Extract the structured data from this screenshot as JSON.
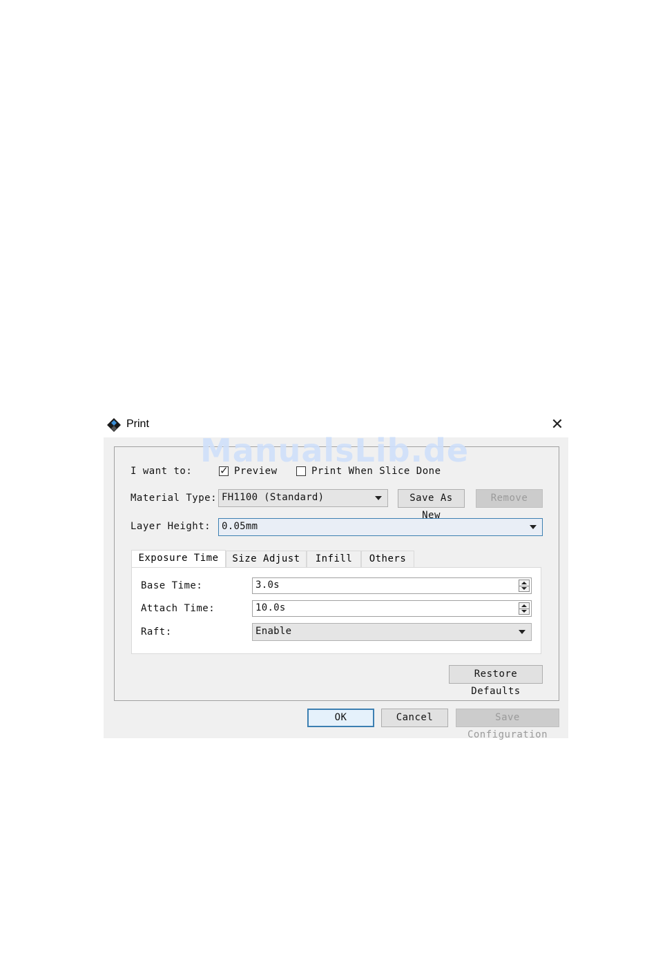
{
  "window": {
    "title": "Print",
    "close_glyph": "✕",
    "icon": "app-diamond-icon"
  },
  "watermark": "ManualsLib.de",
  "want_to": {
    "label": "I want to:",
    "preview": {
      "label": "Preview",
      "checked": true
    },
    "print_when_done": {
      "label": "Print When Slice Done",
      "checked": false
    }
  },
  "material": {
    "label": "Material Type:",
    "value": "FH1100 (Standard)",
    "save_as_new": "Save As New",
    "remove": "Remove"
  },
  "layer_height": {
    "label": "Layer Height:",
    "value": "0.05mm"
  },
  "tabs": [
    {
      "label": "Exposure Time",
      "active": true
    },
    {
      "label": "Size Adjust",
      "active": false
    },
    {
      "label": "Infill",
      "active": false
    },
    {
      "label": "Others",
      "active": false
    }
  ],
  "exposure": {
    "base_time": {
      "label": "Base Time:",
      "value": "3.0s"
    },
    "attach_time": {
      "label": "Attach Time:",
      "value": "10.0s"
    },
    "raft": {
      "label": "Raft:",
      "value": "Enable"
    }
  },
  "restore_defaults": "Restore Defaults",
  "footer": {
    "ok": "OK",
    "cancel": "Cancel",
    "save_configuration": "Save Configuration"
  },
  "colors": {
    "focus_border": "#3c7fb1",
    "dialog_bg": "#f0f0f0",
    "disabled_text": "#9a9a9a"
  }
}
